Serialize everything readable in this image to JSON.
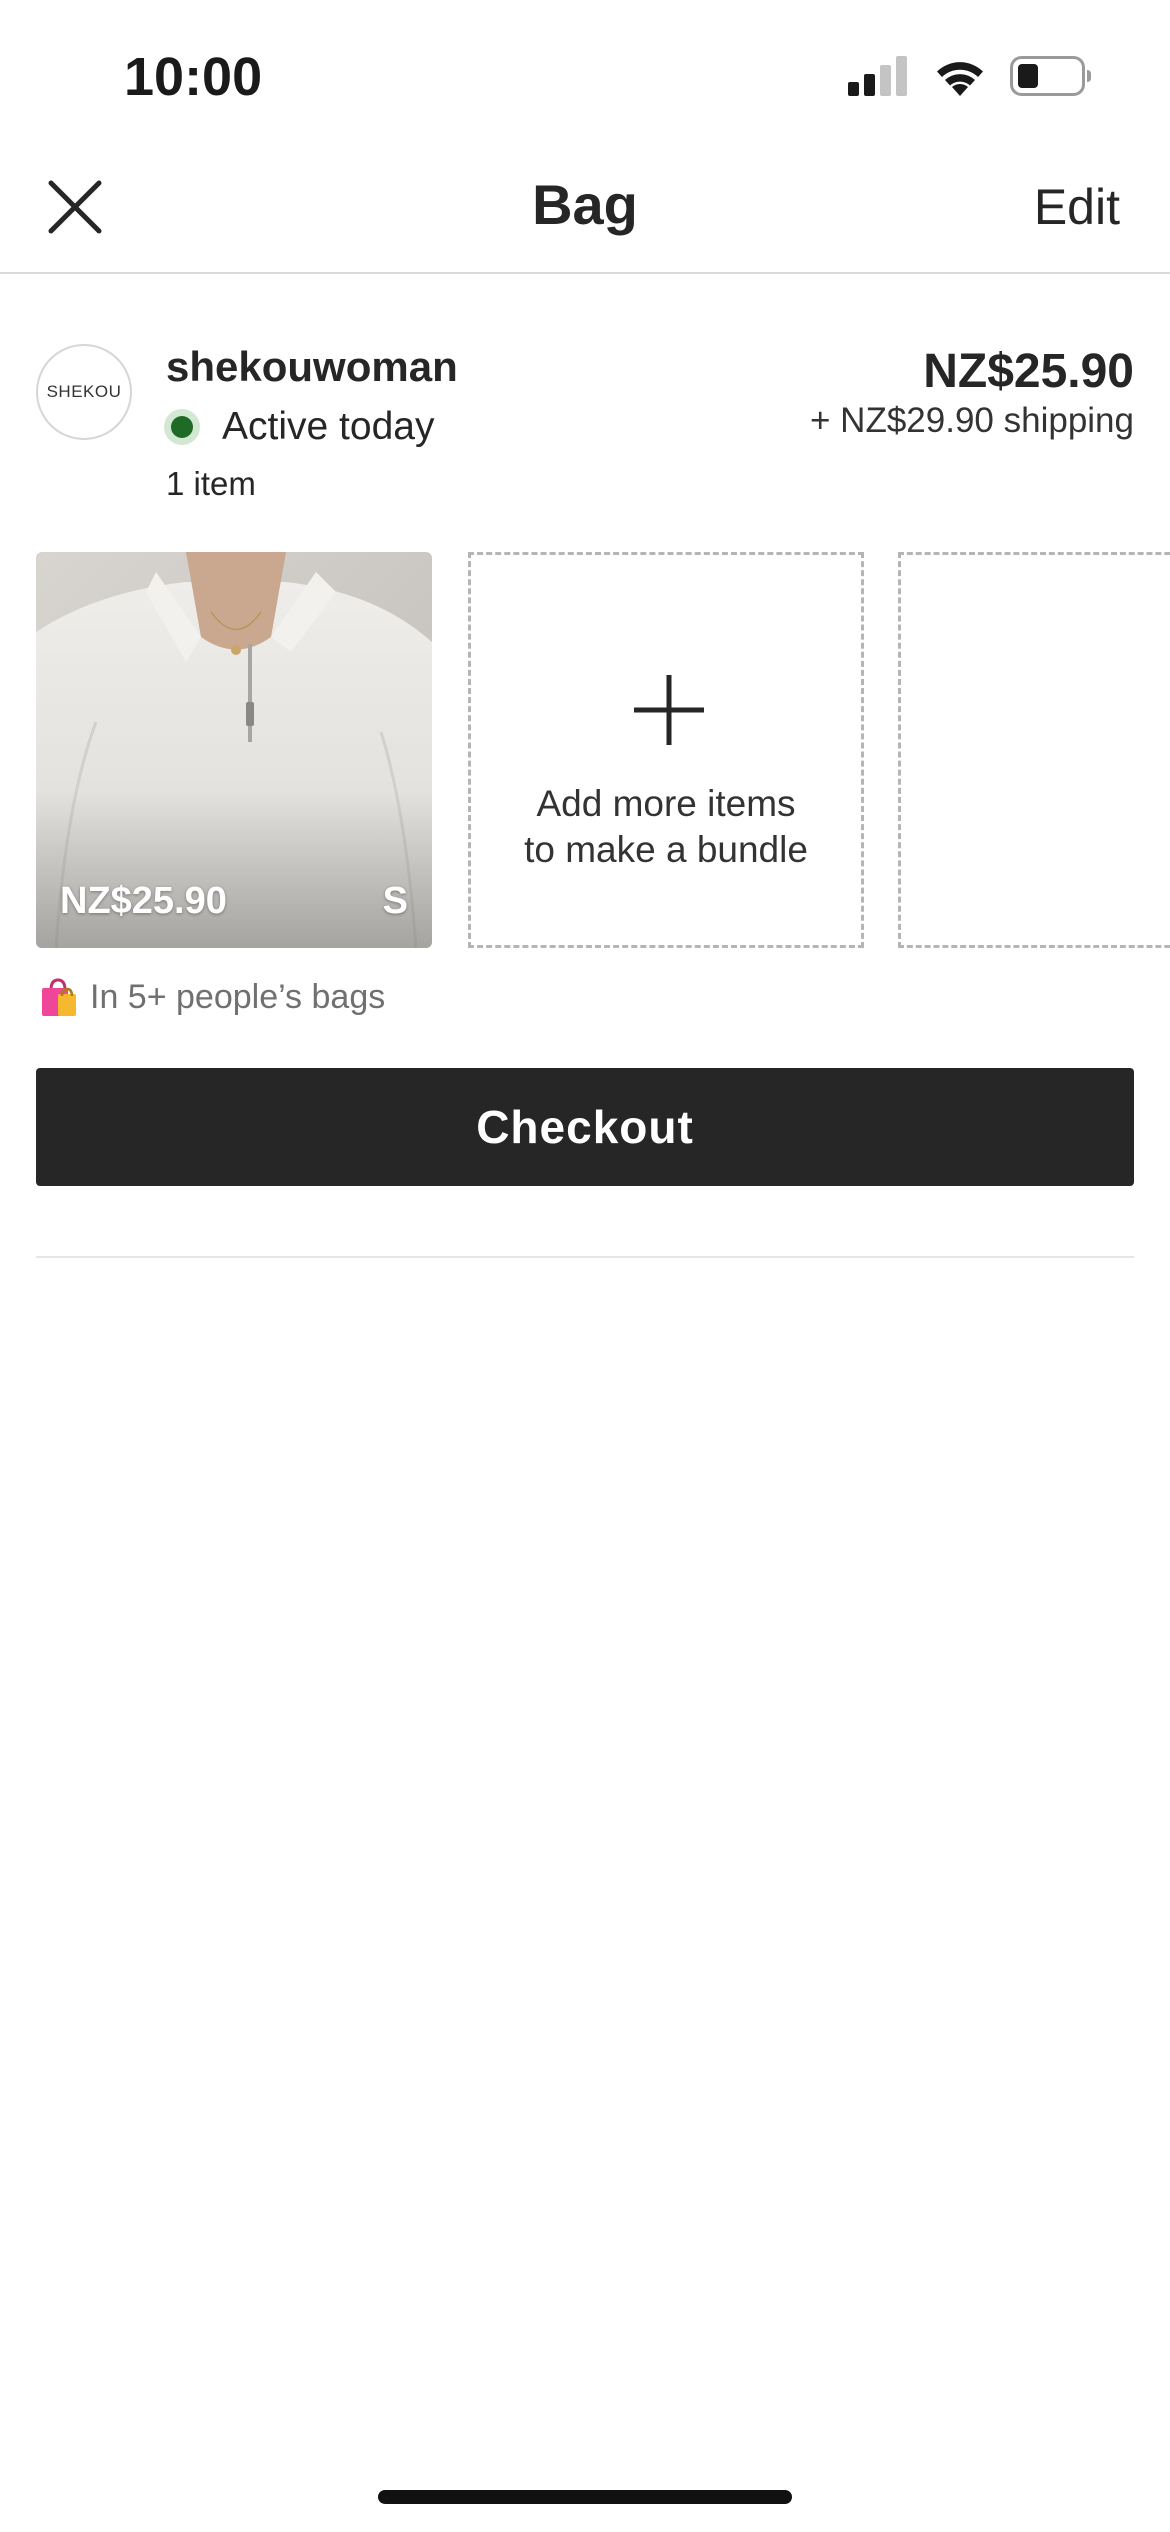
{
  "status_bar": {
    "time": "10:00",
    "icons": [
      "cellular-signal-icon",
      "wifi-icon",
      "battery-icon"
    ]
  },
  "nav": {
    "close_icon": "close-icon",
    "title": "Bag",
    "edit_label": "Edit"
  },
  "seller": {
    "avatar_text": "SHEKOU",
    "name": "shekouwoman",
    "active_status": "Active today",
    "active_color": "#1f6b25",
    "item_count": "1 item",
    "total_price": "NZ$25.90",
    "shipping": "+ NZ$29.90 shipping"
  },
  "items": [
    {
      "price": "NZ$25.90",
      "size": "S",
      "image": "light grey half-zip sweatshirt"
    }
  ],
  "add_more": {
    "icon": "plus-icon",
    "line1": "Add more items",
    "line2": "to make a bundle"
  },
  "social_proof": {
    "icon": "shopping-bags-icon",
    "text": "In 5+ people’s bags"
  },
  "checkout": {
    "label": "Checkout",
    "color": "#262626"
  }
}
